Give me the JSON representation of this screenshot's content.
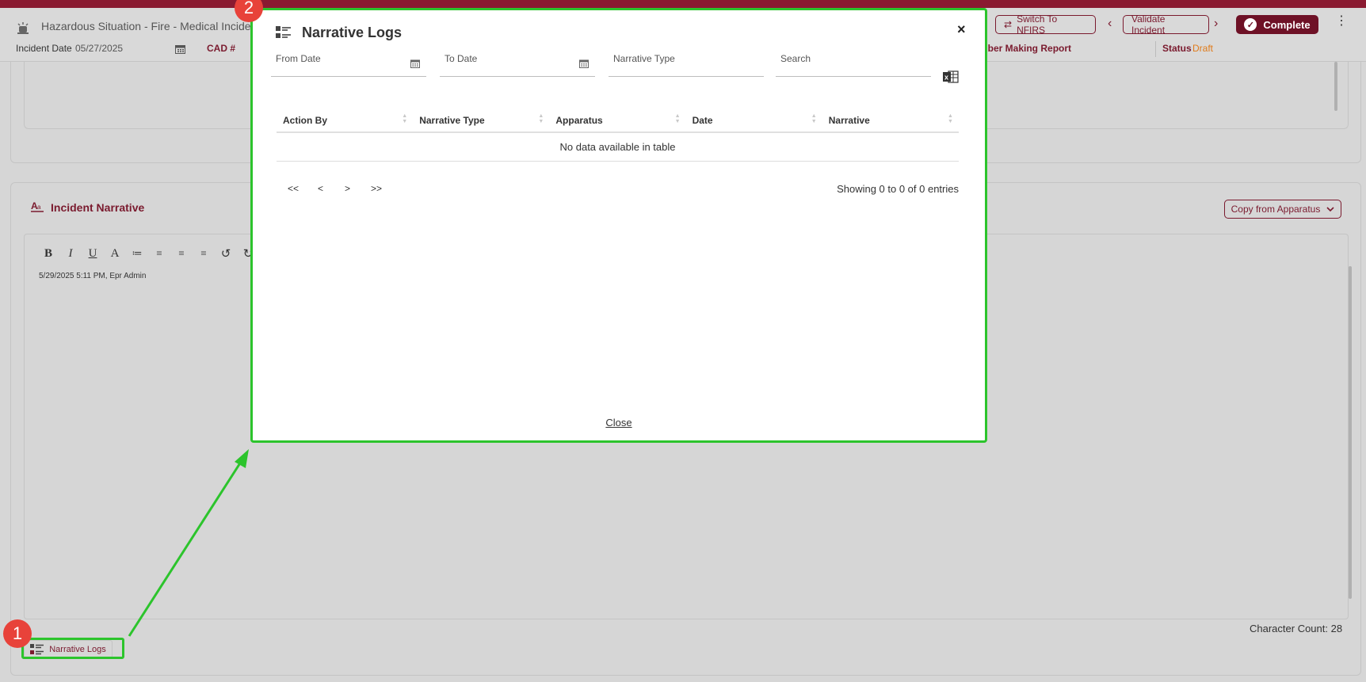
{
  "header": {
    "title": "Hazardous Situation - Fire - Medical Incident",
    "switch_label": "Switch To NFIRS",
    "validate_label": "Validate Incident",
    "complete_label": "Complete",
    "incident_date_label": "Incident Date",
    "incident_date_value": "05/27/2025",
    "cad_label": "CAD #",
    "member_label": "mber Making Report",
    "status_label": "Status",
    "status_value": "Draft"
  },
  "narrative_panel": {
    "title": "Incident Narrative",
    "copy_label": "Copy from Apparatus",
    "toolbar": [
      "B",
      "I",
      "U",
      "A",
      "≔",
      "≡",
      "≡",
      "≡",
      "↺",
      "↻"
    ],
    "editor_text": "5/29/2025 5:11 PM, Epr Admin",
    "char_count": "Character Count: 28",
    "logs_button": "Narrative Logs"
  },
  "modal": {
    "title": "Narrative Logs",
    "close_x": "×",
    "from_date": "From Date",
    "to_date": "To Date",
    "narrative_type": "Narrative Type",
    "search": "Search",
    "columns": [
      "Action By",
      "Narrative Type",
      "Apparatus",
      "Date",
      "Narrative"
    ],
    "empty_text": "No data available in table",
    "pager": {
      "first": "<<",
      "prev": "<",
      "next": ">",
      "last": ">>"
    },
    "showing": "Showing 0 to 0 of 0 entries",
    "close_link": "Close"
  },
  "markers": {
    "one": "1",
    "two": "2"
  },
  "colors": {
    "brand": "#7a1a2e",
    "highlight": "#2cc42c",
    "marker": "#e8423a",
    "status_draft": "#e07b1a"
  }
}
